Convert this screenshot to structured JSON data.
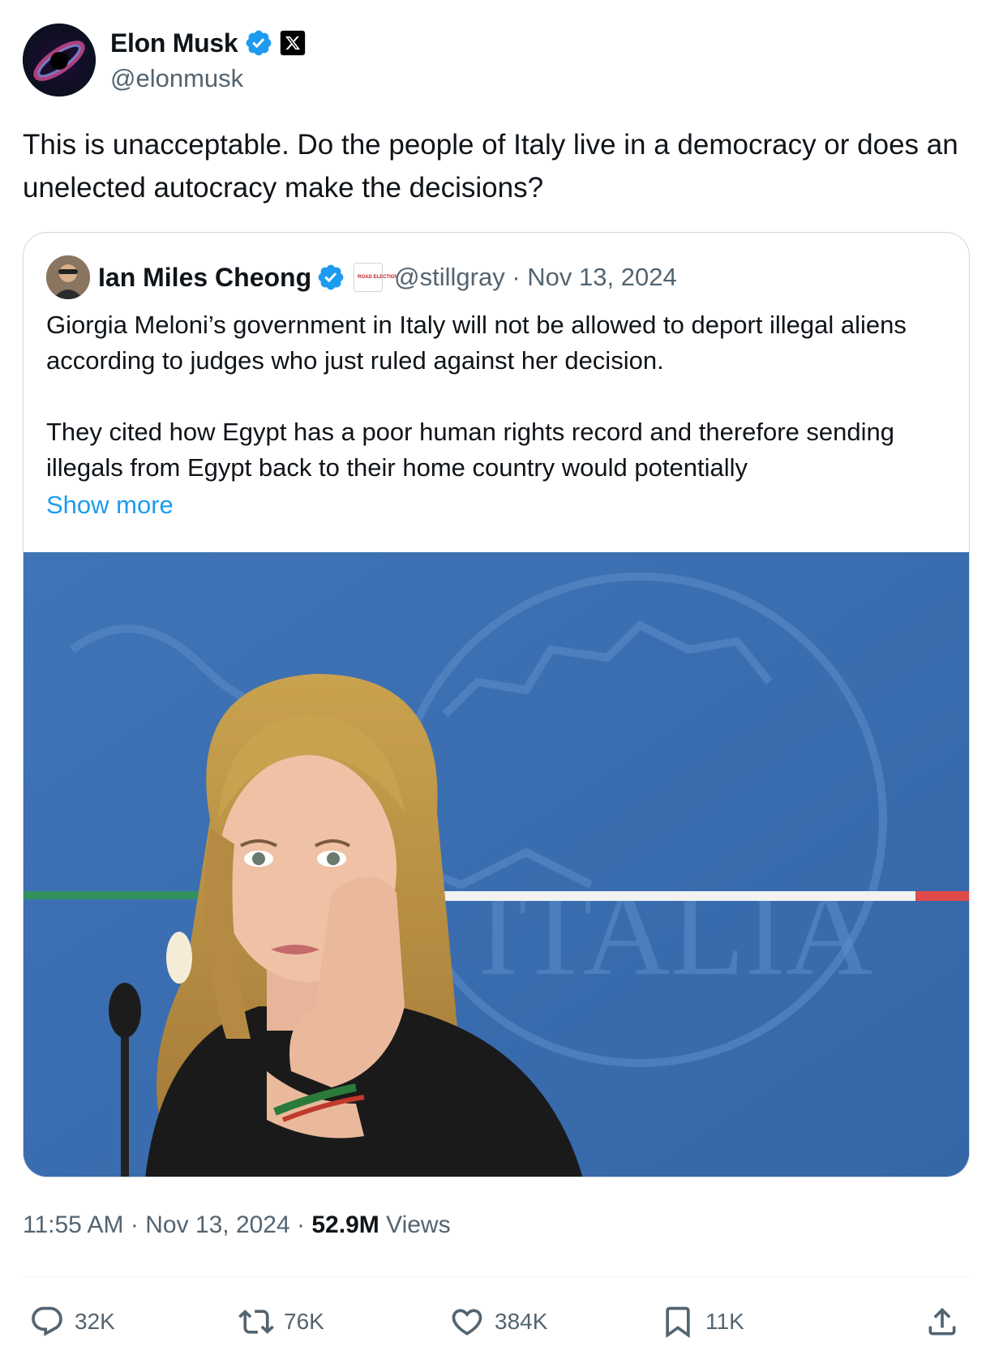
{
  "author": {
    "name": "Elon Musk",
    "handle": "@elonmusk",
    "verified": true,
    "affiliation_icon": "x-logo-badge"
  },
  "tweet": {
    "text": "This is unacceptable. Do the people of Italy live in a democracy or does an unelected autocracy make the decisions?"
  },
  "quoted": {
    "name": "Ian Miles Cheong",
    "handle": "@stillgray",
    "separator": "·",
    "date": "Nov 13, 2024",
    "verified": true,
    "affiliation_badge_text": "ROAD ELECTION",
    "paragraph1": "Giorgia Meloni’s government in Italy will not be allowed to deport illegal aliens according to judges who just ruled against her decision.",
    "paragraph2": "They cited how Egypt has a poor human rights record and therefore sending illegals from Egypt back to their home country would potentially",
    "show_more": "Show more",
    "photo_icon": "photo-of-woman-resting-cheek-on-hand"
  },
  "meta": {
    "time": "11:55 AM",
    "separator": "·",
    "date": "Nov 13, 2024",
    "views_count": "52.9M",
    "views_label": "Views"
  },
  "actions": {
    "replies": "32K",
    "reposts": "76K",
    "likes": "384K",
    "bookmarks": "11K"
  },
  "colors": {
    "accent": "#1d9bf0",
    "text": "#0f1419",
    "secondary": "#536471",
    "border": "#cfd9de"
  }
}
